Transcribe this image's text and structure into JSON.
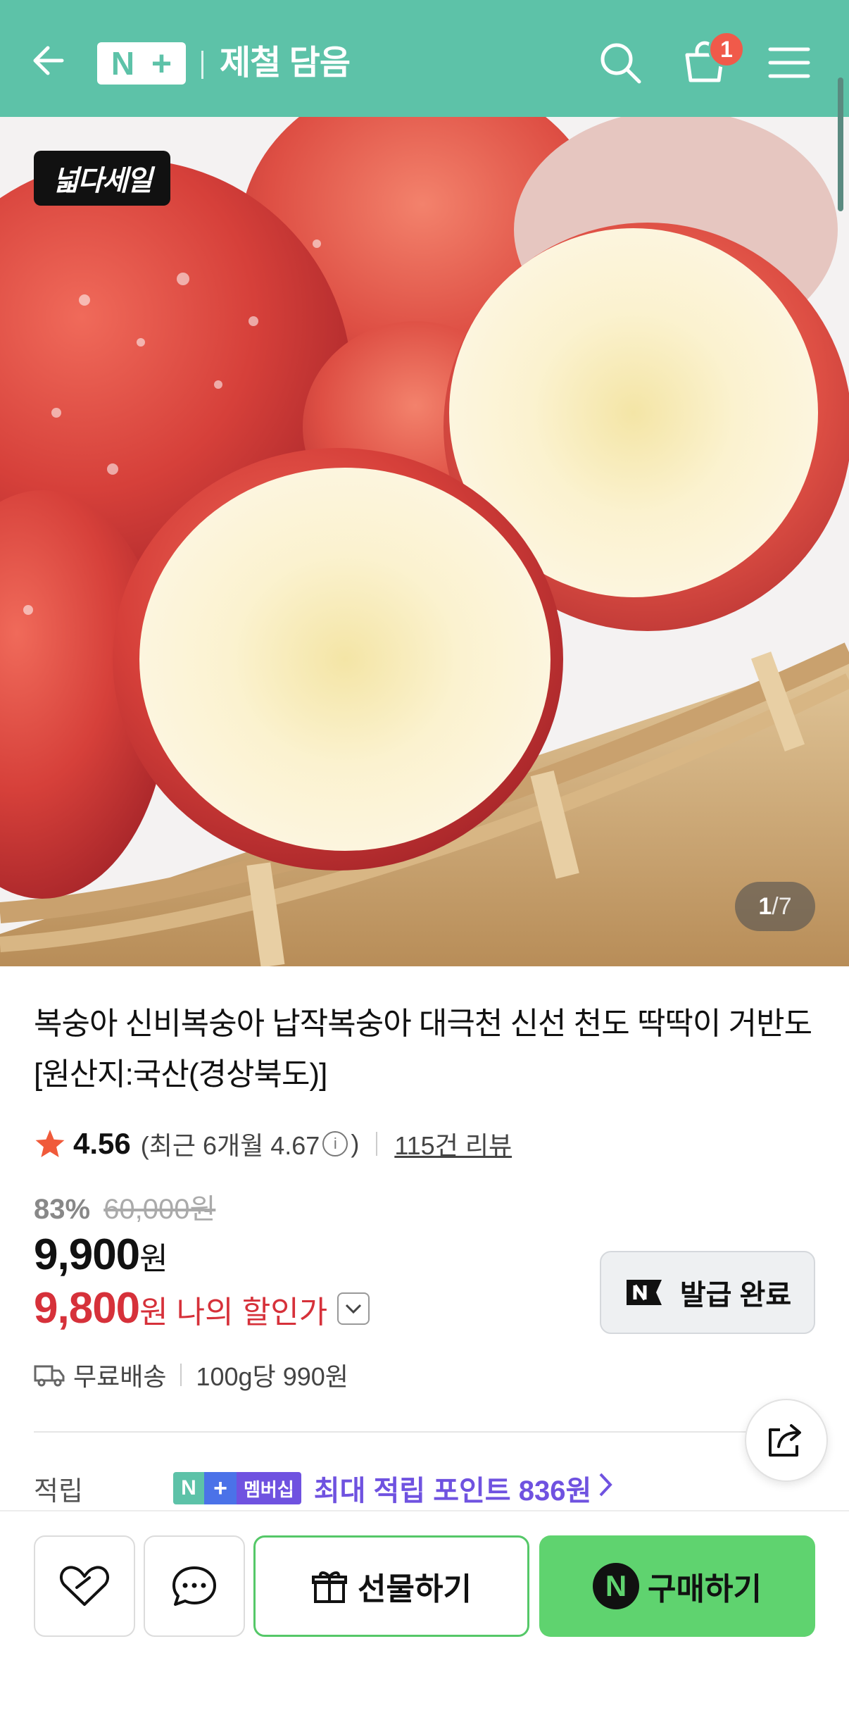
{
  "header": {
    "logo_n": "N",
    "logo_plus": "+",
    "store_name": "제철 담음",
    "cart_count": "1",
    "bg_color": "#5dc2a8"
  },
  "hero": {
    "sale_badge": "넓다세일",
    "counter_current": "1",
    "counter_total": "/7"
  },
  "product": {
    "title": "복숭아 신비복숭아 납작복숭아 대극천 신선 천도 딱딱이 거반도 [원산지:국산(경상북도)]",
    "rating": "4.56",
    "recent_rating_prefix": "(최근 6개월 4.67",
    "recent_rating_suffix": ")",
    "review_link": "115건 리뷰",
    "discount_pct": "83%",
    "original_price": "60,000원",
    "price": "9,900",
    "price_unit": "원",
    "my_price": "9,800",
    "my_price_unit": "원",
    "my_price_label": "나의 할인가",
    "coupon_button": "발급 완료",
    "shipping": "무료배송",
    "unit_price": "100g당 990원",
    "points_label": "적립",
    "membership_badge": "멤버십",
    "points_text": "최대 적립 포인트 836원"
  },
  "bottom_bar": {
    "gift_label": "선물하기",
    "buy_label": "구매하기",
    "buy_icon_letter": "N"
  },
  "colors": {
    "accent_green": "#5dc2a8",
    "buy_green": "#5fd36f",
    "discount_red": "#d6313a",
    "membership_purple": "#6f52e0"
  }
}
